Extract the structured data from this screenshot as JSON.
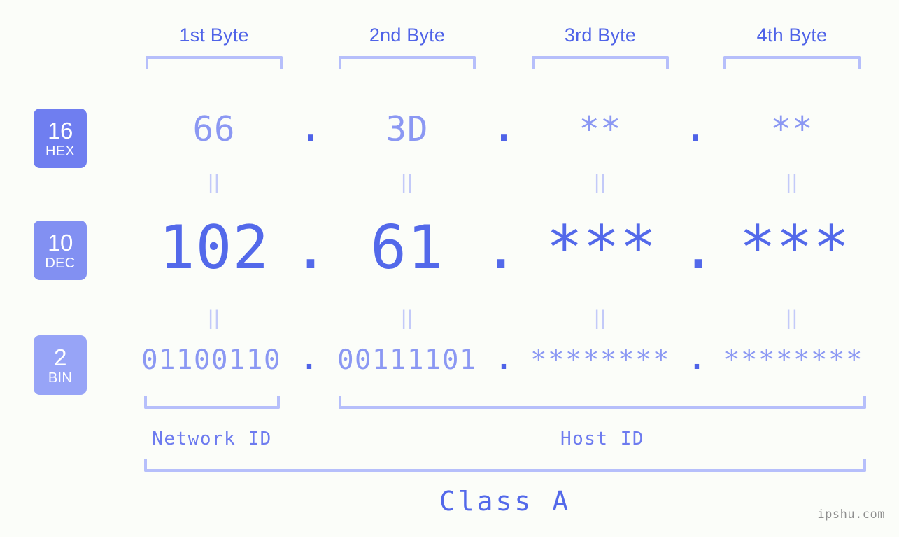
{
  "meta": {
    "watermark": "ipshu.com",
    "background_color": "#fbfdf9",
    "accent_color": "#5369ea",
    "accent_light": "#8b98f3",
    "bracket_color": "#b6bffb"
  },
  "byte_headers": [
    {
      "label": "1st Byte"
    },
    {
      "label": "2nd Byte"
    },
    {
      "label": "3rd Byte"
    },
    {
      "label": "4th Byte"
    }
  ],
  "bases": [
    {
      "number": "16",
      "name": "HEX",
      "color": "#6f7ef0"
    },
    {
      "number": "10",
      "name": "DEC",
      "color": "#8290f2"
    },
    {
      "number": "2",
      "name": "BIN",
      "color": "#97a4f7"
    }
  ],
  "rows": {
    "hex": {
      "base_number": "16",
      "base_name": "HEX",
      "values": [
        "66",
        "3D",
        "**",
        "**"
      ],
      "separators": [
        ".",
        ".",
        "."
      ]
    },
    "dec": {
      "base_number": "10",
      "base_name": "DEC",
      "values": [
        "102",
        "61",
        "***",
        "***"
      ],
      "separators": [
        ".",
        ".",
        "."
      ]
    },
    "bin": {
      "base_number": "2",
      "base_name": "BIN",
      "values": [
        "01100110",
        "00111101",
        "********",
        "********"
      ],
      "separators": [
        ".",
        ".",
        "."
      ]
    }
  },
  "equals_separators": {
    "glyph": "||",
    "rows": [
      [
        "||",
        "||",
        "||",
        "||"
      ],
      [
        "||",
        "||",
        "||",
        "||"
      ]
    ]
  },
  "sections": [
    {
      "label": "Network ID"
    },
    {
      "label": "Host ID"
    }
  ],
  "class": {
    "label": "Class A"
  }
}
